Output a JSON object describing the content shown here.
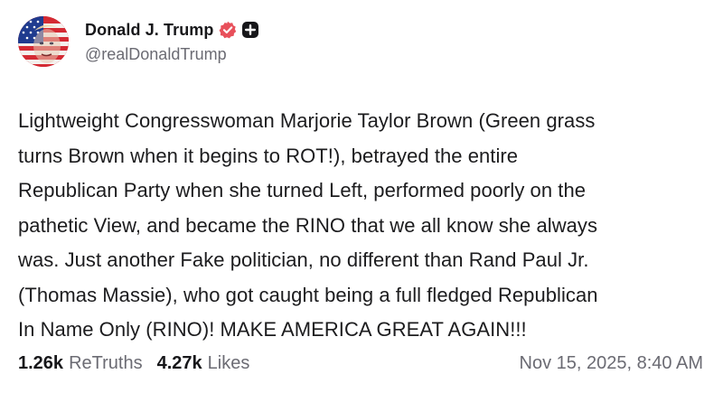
{
  "author": {
    "display_name": "Donald J. Trump",
    "handle": "@realDonaldTrump",
    "avatar_icon": "avatar-flag-face",
    "verified_icon": "verified-badge-icon",
    "verified_color": "#e8505b",
    "plus_icon": "plus-square-icon"
  },
  "post": {
    "text": "Lightweight Congresswoman Marjorie Taylor Brown (Green grass\nturns Brown when it begins to ROT!), betrayed the entire\nRepublican Party when she turned Left, performed poorly on the\npathetic View, and became the RINO that we all know she always\nwas. Just another Fake politician, no different than Rand Paul Jr.\n(Thomas Massie), who got caught being a full fledged Republican\nIn Name Only (RINO)! MAKE AMERICA GREAT AGAIN!!!"
  },
  "stats": {
    "retruths_count": "1.26k",
    "retruths_label": "ReTruths",
    "likes_count": "4.27k",
    "likes_label": "Likes"
  },
  "timestamp": "Nov 15, 2025, 8:40 AM"
}
